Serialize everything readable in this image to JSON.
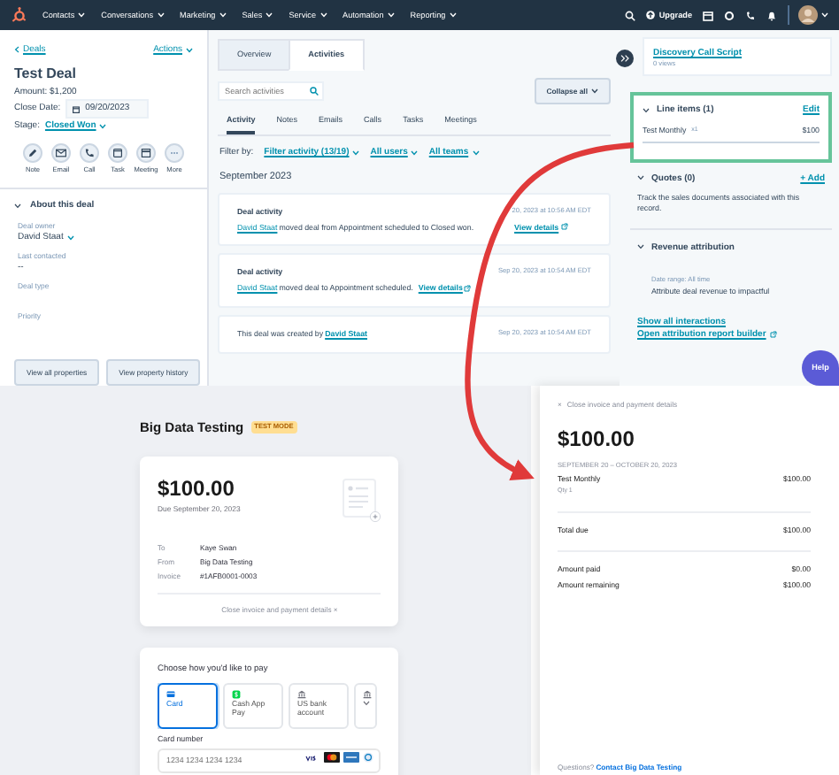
{
  "nav": {
    "items": [
      "Contacts",
      "Conversations",
      "Marketing",
      "Sales",
      "Service",
      "Automation",
      "Reporting"
    ],
    "upgrade": "Upgrade"
  },
  "deal": {
    "back": "Deals",
    "actions": "Actions",
    "title": "Test Deal",
    "amount": "Amount: $1,200",
    "close_date_label": "Close Date:",
    "close_date": "09/20/2023",
    "stage_label": "Stage:",
    "stage": "Closed Won",
    "quick_actions": [
      {
        "kind": "note",
        "label": "Note"
      },
      {
        "kind": "email",
        "label": "Email"
      },
      {
        "kind": "call",
        "label": "Call"
      },
      {
        "kind": "task",
        "label": "Task"
      },
      {
        "kind": "meeting",
        "label": "Meeting"
      },
      {
        "kind": "more",
        "label": "More"
      }
    ],
    "about": "About this deal",
    "properties": [
      {
        "label": "Deal owner",
        "value": "David Staat"
      },
      {
        "label": "Last contacted",
        "value": "--"
      },
      {
        "label": "Deal type"
      },
      {
        "label": "Priority"
      }
    ],
    "buttons": [
      "View all properties",
      "View property history"
    ]
  },
  "activities": {
    "tabs": [
      {
        "label": "Overview",
        "selected": false
      },
      {
        "label": "Activities",
        "selected": true
      }
    ],
    "search": {
      "placeholder": "Search activities"
    },
    "collapse": "Collapse all",
    "subtabs": [
      {
        "label": "Activity",
        "selected": true
      },
      {
        "label": "Notes",
        "selected": false
      },
      {
        "label": "Emails",
        "selected": false
      },
      {
        "label": "Calls",
        "selected": false
      },
      {
        "label": "Tasks",
        "selected": false
      },
      {
        "label": "Meetings",
        "selected": false
      }
    ],
    "filter_label": "Filter by:",
    "filters": [
      "Filter activity (13/19)",
      "All users",
      "All teams"
    ],
    "month": "September 2023",
    "items": [
      {
        "title": "Deal activity",
        "actor": "David Staat",
        "text": "moved deal from Appointment scheduled to Closed won.",
        "link": "View details",
        "time": "20, 2023 at 10:56 AM EDT"
      },
      {
        "title": "Deal activity",
        "actor": "David Staat",
        "text": "moved deal to Appointment scheduled.",
        "link": "View details",
        "time": "Sep 20, 2023 at 10:54 AM EDT"
      },
      {
        "text": "This deal was created by",
        "actor": "David Staat",
        "time": "Sep 20, 2023 at 10:54 AM EDT"
      }
    ]
  },
  "sidebar": {
    "script": {
      "title": "Discovery Call Script",
      "views": "0 views"
    },
    "line_items": {
      "title": "Line items (1)",
      "edit": "Edit",
      "name": "Test Monthly",
      "qty": "x1",
      "price": "$100"
    },
    "quotes": {
      "title": "Quotes (0)",
      "add": "+ Add",
      "text": "Track the sales documents associated with this record."
    },
    "revenue": {
      "title": "Revenue attribution",
      "range": "Date range: All time",
      "text": "Attribute deal revenue to impactful"
    },
    "links": [
      "Show all interactions",
      "Open attribution report builder"
    ],
    "help": "Help"
  },
  "checkout": {
    "merchant": "Big Data Testing",
    "badge": "TEST MODE",
    "amount": "$100.00",
    "due": "Due September 20, 2023",
    "details": [
      {
        "label": "To",
        "value": "Kaye Swan"
      },
      {
        "label": "From",
        "value": "Big Data Testing"
      },
      {
        "label": "Invoice",
        "value": "#1AFB0001-0003"
      }
    ],
    "close": "Close invoice and payment details",
    "close_icon": "×",
    "pay_title": "Choose how you'd like to pay",
    "methods": [
      {
        "kind": "card",
        "label": "Card",
        "selected": true
      },
      {
        "kind": "cashapp",
        "label": "Cash App Pay",
        "selected": false
      },
      {
        "kind": "bank",
        "label": "US bank account",
        "selected": false
      },
      {
        "kind": "more",
        "selected": false
      }
    ],
    "card_label": "Card number",
    "card_placeholder": "1234 1234 1234 1234"
  },
  "summary": {
    "close_icon": "×",
    "close": "Close invoice and payment details",
    "amount": "$100.00",
    "period": "SEPTEMBER 20 – OCTOBER 20, 2023",
    "item": {
      "name": "Test Monthly",
      "qty": "Qty 1",
      "price": "$100.00"
    },
    "rows": [
      {
        "label": "Total due",
        "value": "$100.00"
      },
      {
        "label": "Amount paid",
        "value": "$0.00"
      },
      {
        "label": "Amount remaining",
        "value": "$100.00"
      }
    ],
    "question": "Questions?",
    "contact": "Contact Big Data Testing"
  }
}
